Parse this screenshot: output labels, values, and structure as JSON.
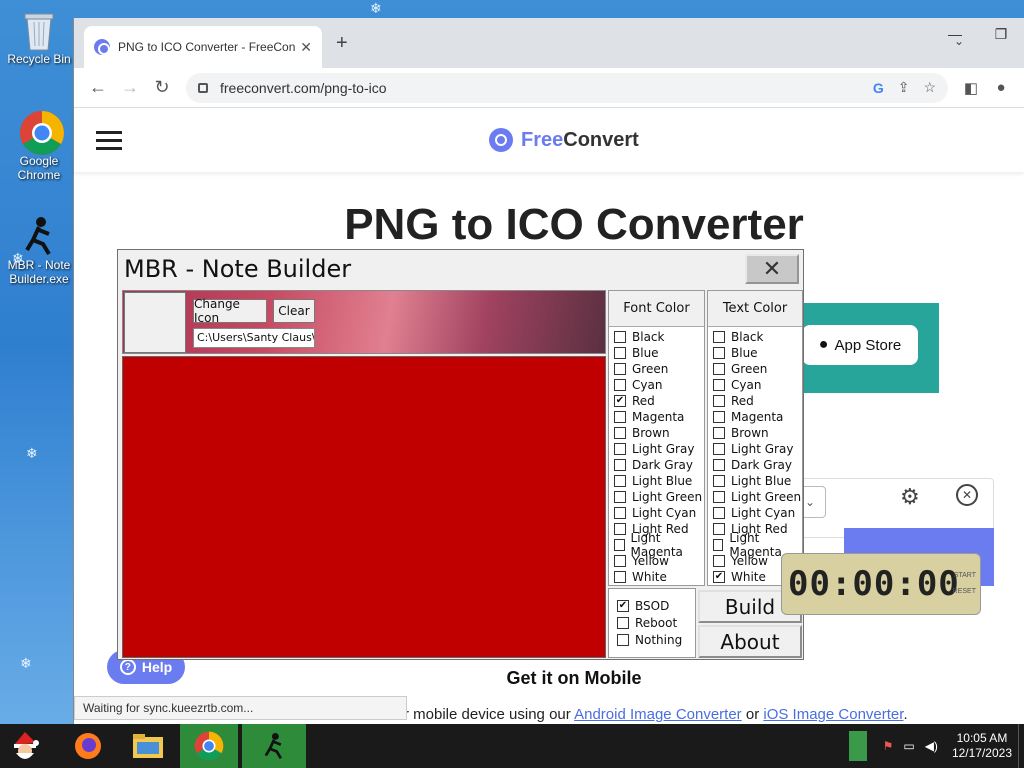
{
  "desktop": {
    "icons": [
      {
        "label": "Recycle Bin"
      },
      {
        "label": "Google Chrome"
      },
      {
        "label": "MBR - Note Builder.exe"
      }
    ]
  },
  "browser": {
    "tab_title": "PNG to ICO Converter - FreeCon",
    "url": "freeconvert.com/png-to-ico",
    "status": "Waiting for sync.kueezrtb.com..."
  },
  "site": {
    "brand_a": "Free",
    "brand_b": "Convert",
    "title": "PNG to ICO Converter",
    "app_store": "App Store",
    "help": "Help",
    "mobile_title": "Get it on Mobile",
    "mobile_text_pre": "r mobile device using our ",
    "mobile_link1": "Android Image Converter",
    "mobile_text_mid": " or ",
    "mobile_link2": "iOS Image Converter",
    "mobile_text_post": "."
  },
  "mbr": {
    "title": "MBR - Note Builder",
    "change_icon": "Change Icon",
    "clear": "Clear",
    "path": "C:\\Users\\Santy Claus\\D",
    "font_color_head": "Font Color",
    "text_color_head": "Text Color",
    "colors": [
      "Black",
      "Blue",
      "Green",
      "Cyan",
      "Red",
      "Magenta",
      "Brown",
      "Light Gray",
      "Dark Gray",
      "Light Blue",
      "Light Green",
      "Light Cyan",
      "Light Red",
      "Light Magenta",
      "Yellow",
      "White"
    ],
    "font_checked": "Red",
    "text_checked": "White",
    "options": [
      {
        "label": "BSOD",
        "checked": true
      },
      {
        "label": "Reboot",
        "checked": false
      },
      {
        "label": "Nothing",
        "checked": false
      }
    ],
    "build": "Build",
    "about": "About"
  },
  "timer": {
    "display": "00:00:00",
    "start": "START",
    "reset": "RESET"
  },
  "taskbar": {
    "time": "10:05 AM",
    "date": "12/17/2023"
  }
}
